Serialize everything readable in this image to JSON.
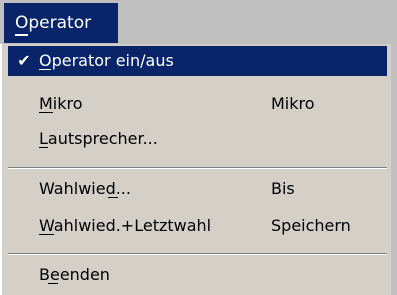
{
  "menubar": {
    "title": "Operator"
  },
  "menu": {
    "items": [
      {
        "label": "Operator ein/aus",
        "shortcut": "",
        "checked": true,
        "selected": true
      },
      {
        "label": "Mikro",
        "shortcut": "Mikro",
        "checked": false,
        "selected": false
      },
      {
        "label": "Lautsprecher...",
        "shortcut": "",
        "checked": false,
        "selected": false
      },
      {
        "label": "Wahlwied...",
        "shortcut": "Bis",
        "checked": false,
        "selected": false
      },
      {
        "label": "Wahlwied.+Letztwahl",
        "shortcut": "Speichern",
        "checked": false,
        "selected": false
      },
      {
        "label": "Beenden",
        "shortcut": "",
        "checked": false,
        "selected": false
      }
    ],
    "check_glyph": "✔"
  },
  "colors": {
    "highlight": "#0a246a",
    "menu_background": "#d4d0c8"
  }
}
